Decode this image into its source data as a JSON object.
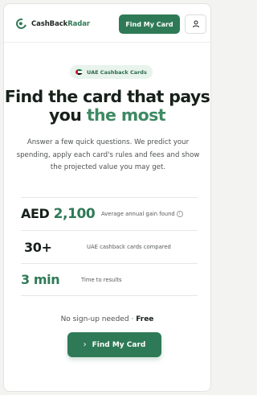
{
  "header": {
    "logo_text_dark": "CashBack",
    "logo_text_accent": "Radar",
    "find_card_label": "Find My Card",
    "user_icon": "user-icon"
  },
  "badge": {
    "label": "UAE Cashback Cards",
    "icon": "uae-flag-icon"
  },
  "hero": {
    "line1": "Find the card that pays",
    "line2_dark": "you",
    "line2_accent": "the most",
    "description": "Answer a few quick questions. We predict your spending, apply each card's rules and fees and show the projected value you may get."
  },
  "stats": [
    {
      "prefix": "AED",
      "value": "2,100",
      "label": "Average annual gain found"
    },
    {
      "prefix": "",
      "value": "30+",
      "label": "UAE cashback cards compared"
    },
    {
      "prefix": "",
      "value": "3 min",
      "label": "Time to results"
    }
  ],
  "footer": {
    "no_signup": "No sign-up needed",
    "separator": "·",
    "free": "Free",
    "cta_label": "Find My Card",
    "cta_icon": "chevron-right-icon"
  },
  "colors": {
    "accent": "#2f7a56",
    "accent_light": "#e7f3ec",
    "heading": "#17201b"
  }
}
